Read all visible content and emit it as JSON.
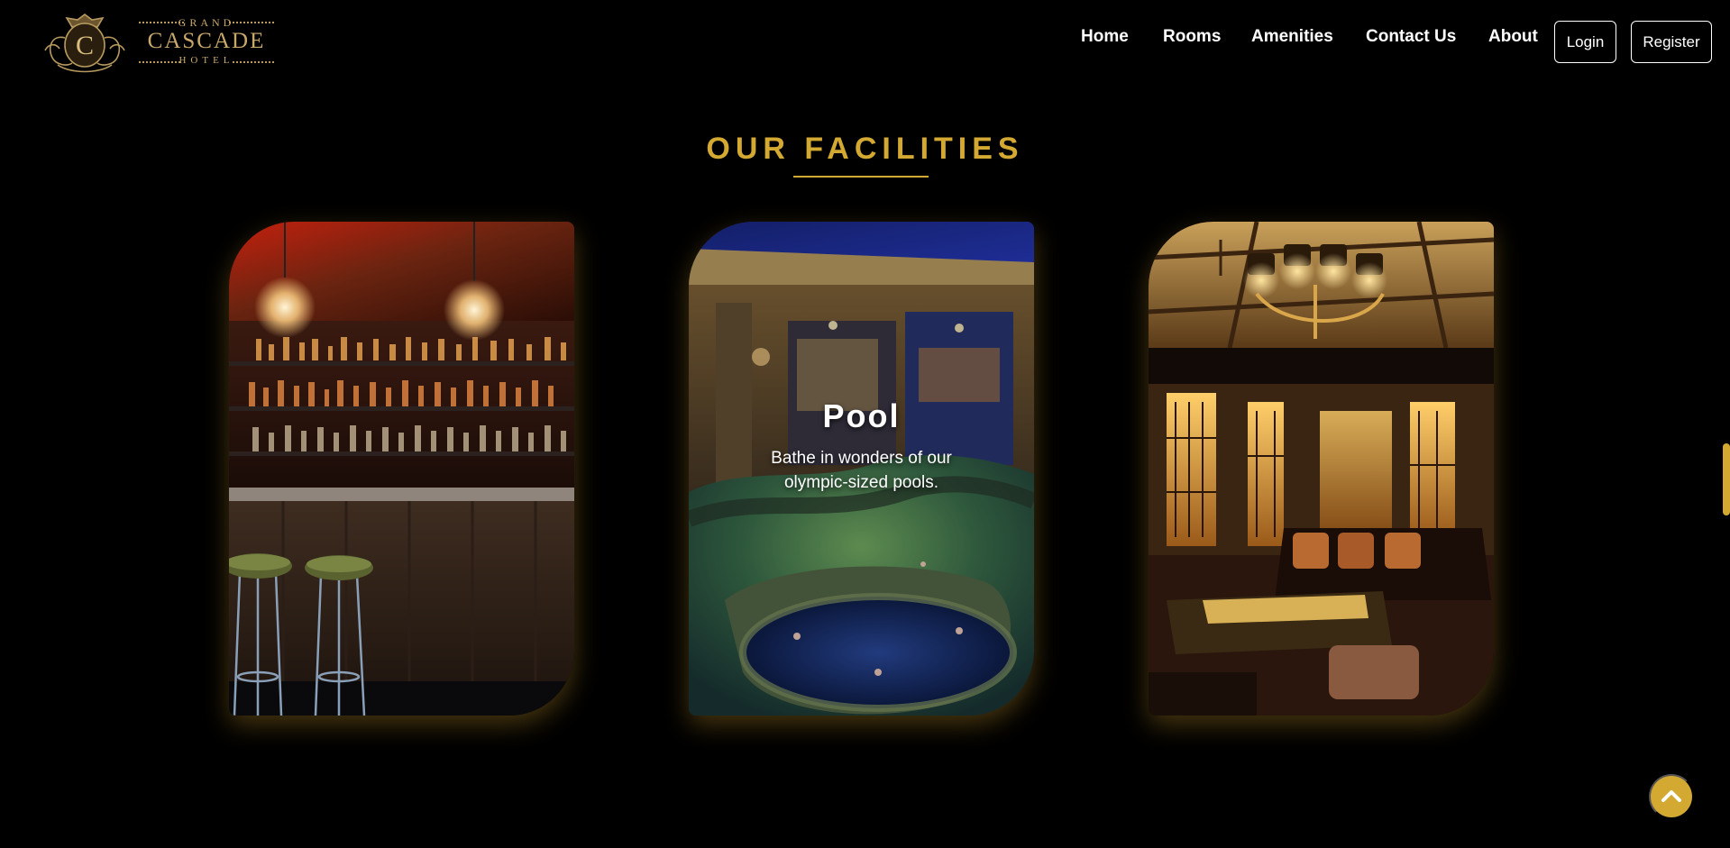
{
  "brand": {
    "logo_initial": "C",
    "line_top": "GRAND",
    "line_main": "CASCADE",
    "line_bottom": "HOTEL"
  },
  "nav": {
    "items": [
      {
        "label": "Home"
      },
      {
        "label": "Rooms"
      },
      {
        "label": "Amenities"
      },
      {
        "label": "Contact Us"
      },
      {
        "label": "About"
      }
    ],
    "login_label": "Login",
    "register_label": "Register"
  },
  "section": {
    "title": "OUR FACILITIES"
  },
  "cards": [
    {
      "image": "bar-photo",
      "title": "",
      "description": ""
    },
    {
      "image": "pool-photo",
      "title": "Pool",
      "description": "Bathe in wonders of our olympic-sized pools."
    },
    {
      "image": "lounge-photo",
      "title": "",
      "description": ""
    }
  ],
  "back_to_top": {
    "icon": "chevron-up-icon"
  },
  "colors": {
    "background": "#000000",
    "accent_gold": "#d4a932",
    "logo_gold": "#c9a96a",
    "text": "#ffffff"
  }
}
